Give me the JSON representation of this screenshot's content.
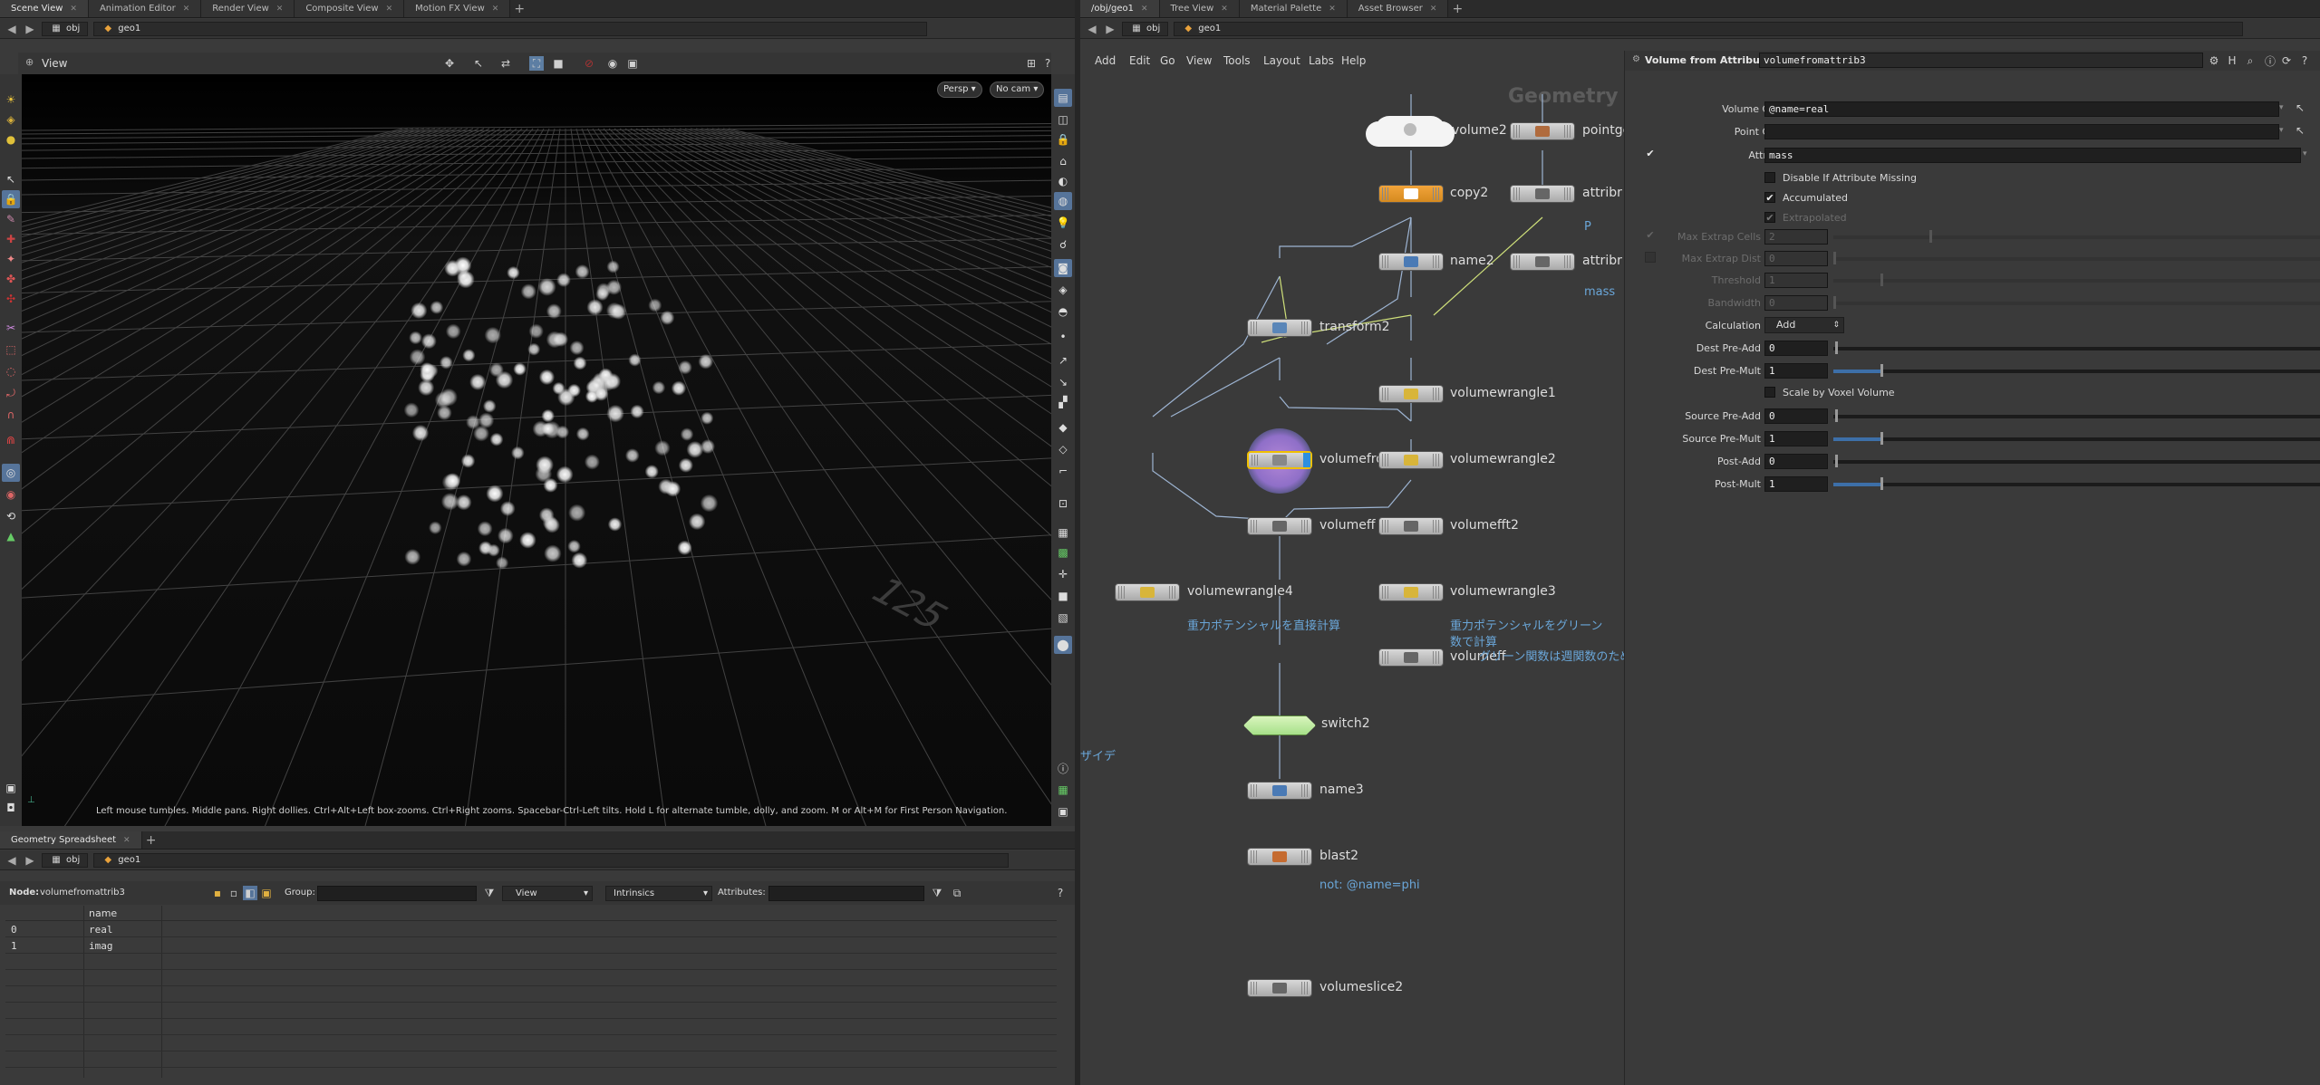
{
  "left_tabs": [
    "Scene View",
    "Animation Editor",
    "Render View",
    "Composite View",
    "Motion FX View"
  ],
  "right_tabs": [
    "/obj/geo1",
    "Tree View",
    "Material Palette",
    "Asset Browser"
  ],
  "spreadsheet_tab": "Geometry Spreadsheet",
  "path": {
    "obj": "obj",
    "geo": "geo1"
  },
  "viewport": {
    "title": "View",
    "persp": "Persp",
    "cam": "No cam",
    "hint": "Left mouse tumbles. Middle pans. Right dollies. Ctrl+Alt+Left box-zooms. Ctrl+Right zooms. Spacebar-Ctrl-Left tilts. Hold L for alternate tumble, dolly, and zoom.     M or Alt+M for First Person Navigation.",
    "grid_number": "125"
  },
  "network": {
    "menu": [
      "Add",
      "Edit",
      "Go",
      "View",
      "Tools",
      "Layout",
      "Labs",
      "Help"
    ],
    "context_label": "Geometry",
    "nodes": {
      "volume2": "volume2",
      "pointg": "pointge",
      "copy2": "copy2",
      "attribr1": "attribr",
      "attribr1_sub": "P",
      "name2": "name2",
      "attribr2": "attribr",
      "attribr2_sub": "mass",
      "transform2": "transform2",
      "vw1": "volumewrangle1",
      "vfa": "volumefro",
      "vw2": "volumewrangle2",
      "vfft1": "volumeff",
      "vfft2": "volumefft2",
      "vw4": "volumewrangle4",
      "vw4_sub": "重力ポテンシャルを直接計算",
      "vw3": "volumewrangle3",
      "vw3_sub1": "重力ポテンシャルをグリーン",
      "vw3_sub2": "数で計算",
      "vfft3": "volumeff",
      "vfft3_overlap": "グリーン関数は週関数のため",
      "switch2": "switch2",
      "name3": "name3",
      "blast2": "blast2",
      "blast2_sub": "not: @name=phi",
      "vslice2": "volumeslice2",
      "side_label": "ザイデ"
    }
  },
  "params": {
    "node_type": "Volume from Attribute",
    "node_name": "volumefromattrib3",
    "volume_group_label": "Volume Group",
    "volume_group": "@name=real",
    "point_group_label": "Point Group",
    "point_group": "",
    "attribute_label": "Attribute",
    "attribute": "mass",
    "disable_missing": "Disable If Attribute Missing",
    "accumulated": "Accumulated",
    "extrapolated": "Extrapolated",
    "max_extrap_cells_label": "Max Extrap Cells",
    "max_extrap_cells": "2",
    "max_extrap_dist_label": "Max Extrap Dist",
    "max_extrap_dist": "0",
    "threshold_label": "Threshold",
    "threshold": "1",
    "bandwidth_label": "Bandwidth",
    "bandwidth": "0",
    "calculation_label": "Calculation",
    "calculation": "Add",
    "dest_pre_add_label": "Dest Pre-Add",
    "dest_pre_add": "0",
    "dest_pre_mult_label": "Dest Pre-Mult",
    "dest_pre_mult": "1",
    "scale_voxel": "Scale by Voxel Volume",
    "source_pre_add_label": "Source Pre-Add",
    "source_pre_add": "0",
    "source_pre_mult_label": "Source Pre-Mult",
    "source_pre_mult": "1",
    "post_add_label": "Post-Add",
    "post_add": "0",
    "post_mult_label": "Post-Mult",
    "post_mult": "1"
  },
  "spreadsheet": {
    "node_label": "Node:",
    "node": "volumefromattrib3",
    "group_label": "Group:",
    "view": "View",
    "intrinsics": "Intrinsics",
    "attributes_label": "Attributes:",
    "column": "name",
    "rows": [
      {
        "idx": "0",
        "name": "real"
      },
      {
        "idx": "1",
        "name": "imag"
      }
    ]
  }
}
